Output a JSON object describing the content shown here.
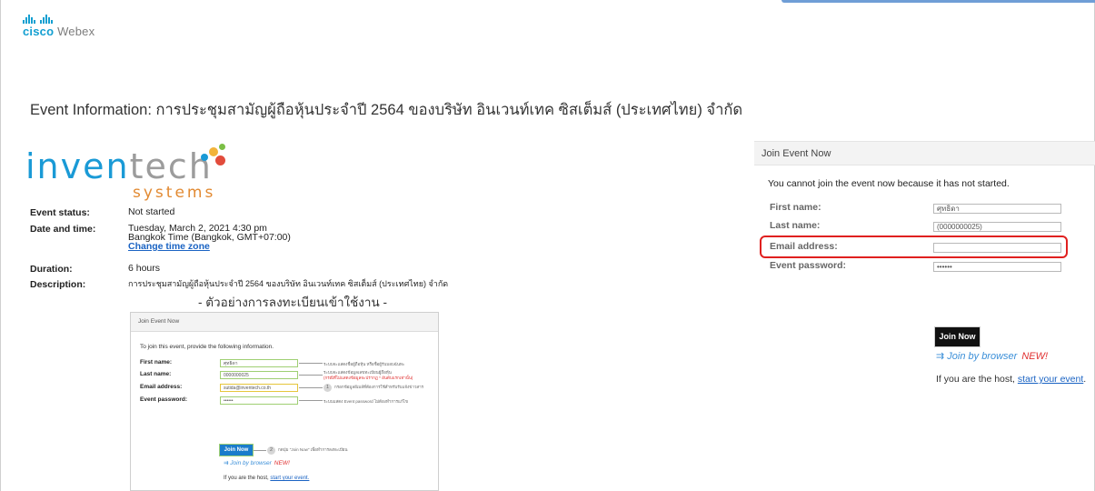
{
  "brand": {
    "company": "cisco",
    "product": "Webex"
  },
  "page": {
    "title": "Event Information: การประชุมสามัญผู้ถือหุ้นประจำปี 2564 ของบริษัท อินเวนท์เทค ซิสเต็มส์ (ประเทศไทย) จำกัด"
  },
  "event_logo": {
    "word_blue": "inven",
    "word_grey": "tech",
    "sub": "systems"
  },
  "event": {
    "status_label": "Event status:",
    "status_value": "Not started",
    "date_label": "Date and time:",
    "date_value": "Tuesday, March 2, 2021 4:30 pm",
    "timezone_value": "Bangkok Time (Bangkok, GMT+07:00)",
    "change_timezone": "Change time zone",
    "duration_label": "Duration:",
    "duration_value": "6 hours",
    "description_label": "Description:",
    "description_value": "การประชุมสามัญผู้ถือหุ้นประจำปี 2564 ของบริษัท อินเวนท์เทค ซิสเต็มส์ (ประเทศไทย) จำกัด"
  },
  "sample": {
    "heading": "- ตัวอย่างการลงทะเบียนเข้าใช้งาน -",
    "panel_title": "Join Event Now",
    "instruction": "To join this event, provide the following information.",
    "first_name_label": "First name:",
    "first_name_value": "ศุทธิดา",
    "last_name_label": "Last name:",
    "last_name_value": "0000000025",
    "email_label": "Email address:",
    "email_value": "sutida@inventech.co.th",
    "password_label": "Event password:",
    "password_value": "••••••",
    "note_1": "ระบบจะแสดงชื่อผู้ถือหุ้น หรือชื่อผู้รับมอบฉันทะ",
    "note_2a": "ระบบจะแสดงข้อมูลเลขทะเบียนผู้ถือหุ้น",
    "note_2b": "(กรณีที่ไม่แสดงข้อมูลจะปรากฏ * อันดับแรกเท่านั้น)",
    "note_3": "กรอกข้อมูลอีเมล์ที่ต้องการใช้สำหรับรับแจ้งข่าวสาร",
    "note_4": "ระบบแสดง Event password ไม่ต้องทำการแก้ไข",
    "note_5": "กดปุ่ม \"Join Now\" เพื่อทำการลงทะเบียน",
    "step_1": "1",
    "step_2": "2",
    "join_button": "Join Now",
    "browser": "Join by browser",
    "new_badge": "NEW!",
    "host_text": "If you are the host,",
    "host_link": "start your event."
  },
  "join_panel": {
    "title": "Join Event Now",
    "message": "You cannot join the event now because it has not started.",
    "first_name_label": "First name:",
    "first_name_value": "ศุทธิดา",
    "last_name_label": "Last name:",
    "last_name_value": "(0000000025)",
    "email_label": "Email address:",
    "email_value": "",
    "password_label": "Event password:",
    "password_value": "••••••",
    "join_button": "Join Now",
    "browser": "Join by browser",
    "new_badge": "NEW!",
    "host_text": "If you are the host,",
    "host_link": "start your event",
    "host_end": "."
  },
  "colors": {
    "webex_blue": "#139fd1",
    "highlight": "#e0201f",
    "link": "#1a63c3",
    "new_red": "#e03131"
  }
}
